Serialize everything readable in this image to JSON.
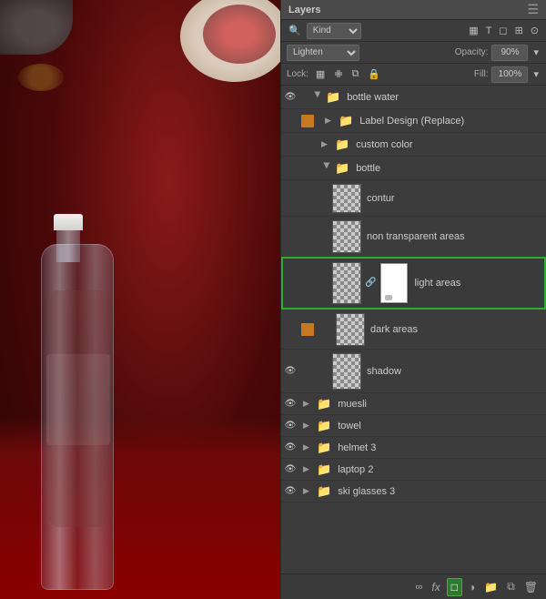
{
  "panel": {
    "title": "Layers",
    "close_label": "×",
    "kind_label": "Kind",
    "blend_mode": "Lighten",
    "opacity_label": "Opacity:",
    "opacity_value": "90%",
    "lock_label": "Lock:",
    "fill_label": "Fill:",
    "fill_value": "100%"
  },
  "layers": [
    {
      "id": "bottle_water",
      "name": "bottle water",
      "type": "group",
      "eye": true,
      "orange": false,
      "indent": 0,
      "expanded": true
    },
    {
      "id": "label_design",
      "name": "Label Design (Replace)",
      "type": "group",
      "eye": false,
      "orange": true,
      "indent": 1,
      "expanded": false
    },
    {
      "id": "custom_color",
      "name": "custom color",
      "type": "group",
      "eye": false,
      "orange": false,
      "indent": 1,
      "expanded": false
    },
    {
      "id": "bottle",
      "name": "bottle",
      "type": "group",
      "eye": false,
      "orange": false,
      "indent": 1,
      "expanded": true
    },
    {
      "id": "contur",
      "name": "contur",
      "type": "layer",
      "eye": false,
      "orange": false,
      "indent": 2,
      "thumb": "checker"
    },
    {
      "id": "non_transparent",
      "name": "non transparent areas",
      "type": "layer",
      "eye": false,
      "orange": false,
      "indent": 2,
      "thumb": "checker"
    },
    {
      "id": "light_areas",
      "name": "light areas",
      "type": "layer",
      "eye": false,
      "orange": false,
      "indent": 2,
      "thumb": "white",
      "highlighted": true,
      "tall": true
    },
    {
      "id": "dark_areas",
      "name": "dark areas",
      "type": "layer",
      "eye": false,
      "orange": true,
      "indent": 2,
      "thumb": "checker"
    },
    {
      "id": "shadow",
      "name": "shadow",
      "type": "layer",
      "eye": true,
      "orange": false,
      "indent": 2,
      "thumb": "checker"
    },
    {
      "id": "muesli",
      "name": "muesli",
      "type": "group",
      "eye": true,
      "orange": false,
      "indent": 0,
      "expanded": false
    },
    {
      "id": "towel",
      "name": "towel",
      "type": "group",
      "eye": true,
      "orange": false,
      "indent": 0,
      "expanded": false
    },
    {
      "id": "helmet3",
      "name": "helmet 3",
      "type": "group",
      "eye": true,
      "orange": false,
      "indent": 0,
      "expanded": false
    },
    {
      "id": "laptop2",
      "name": "laptop 2",
      "type": "group",
      "eye": true,
      "orange": false,
      "indent": 0,
      "expanded": false
    },
    {
      "id": "ski_glasses3",
      "name": "ski glasses 3",
      "type": "group",
      "eye": true,
      "orange": false,
      "indent": 0,
      "expanded": false
    }
  ],
  "footer": {
    "link_label": "∞",
    "fx_label": "fx",
    "active_label": "□",
    "circle_label": "◎",
    "folder_label": "📁",
    "copy_label": "⧉",
    "trash_label": "🗑"
  }
}
